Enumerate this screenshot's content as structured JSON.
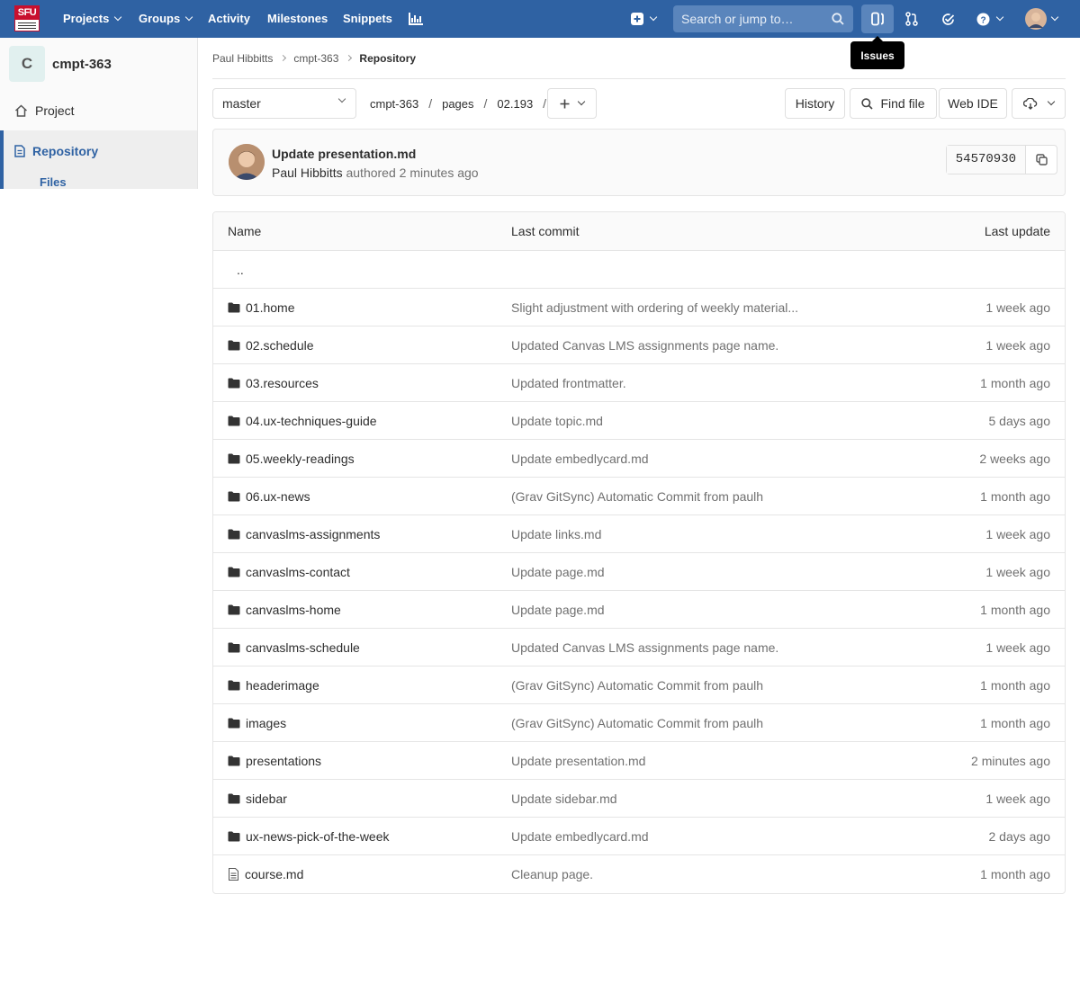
{
  "navbar": {
    "logo_text": "SFU",
    "links": [
      "Projects",
      "Groups",
      "Activity",
      "Milestones",
      "Snippets"
    ],
    "search_placeholder": "Search or jump to…",
    "tooltip": "Issues"
  },
  "sidebar": {
    "project_initial": "C",
    "project_name": "cmpt-363",
    "items": [
      "Project",
      "Repository"
    ],
    "sub_item": "Files"
  },
  "breadcrumb": [
    "Paul Hibbitts",
    "cmpt-363",
    "Repository"
  ],
  "toolbar": {
    "branch": "master",
    "path": [
      "cmpt-363",
      "pages",
      "02.193"
    ],
    "history": "History",
    "find_file": "Find file",
    "web_ide": "Web IDE"
  },
  "commit": {
    "title": "Update presentation.md",
    "author": "Paul Hibbitts",
    "meta": "authored 2 minutes ago",
    "sha": "54570930"
  },
  "table": {
    "headers": [
      "Name",
      "Last commit",
      "Last update"
    ],
    "parent": "..",
    "rows": [
      {
        "name": "01.home",
        "type": "folder",
        "commit": "Slight adjustment with ordering of weekly material...",
        "update": "1 week ago"
      },
      {
        "name": "02.schedule",
        "type": "folder",
        "commit": "Updated Canvas LMS assignments page name.",
        "update": "1 week ago"
      },
      {
        "name": "03.resources",
        "type": "folder",
        "commit": "Updated frontmatter.",
        "update": "1 month ago"
      },
      {
        "name": "04.ux-techniques-guide",
        "type": "folder",
        "commit": "Update topic.md",
        "update": "5 days ago"
      },
      {
        "name": "05.weekly-readings",
        "type": "folder",
        "commit": "Update embedlycard.md",
        "update": "2 weeks ago"
      },
      {
        "name": "06.ux-news",
        "type": "folder",
        "commit": "(Grav GitSync) Automatic Commit from paulh",
        "update": "1 month ago"
      },
      {
        "name": "canvaslms-assignments",
        "type": "folder",
        "commit": "Update links.md",
        "update": "1 week ago"
      },
      {
        "name": "canvaslms-contact",
        "type": "folder",
        "commit": "Update page.md",
        "update": "1 week ago"
      },
      {
        "name": "canvaslms-home",
        "type": "folder",
        "commit": "Update page.md",
        "update": "1 month ago"
      },
      {
        "name": "canvaslms-schedule",
        "type": "folder",
        "commit": "Updated Canvas LMS assignments page name.",
        "update": "1 week ago"
      },
      {
        "name": "headerimage",
        "type": "folder",
        "commit": "(Grav GitSync) Automatic Commit from paulh",
        "update": "1 month ago"
      },
      {
        "name": "images",
        "type": "folder",
        "commit": "(Grav GitSync) Automatic Commit from paulh",
        "update": "1 month ago"
      },
      {
        "name": "presentations",
        "type": "folder",
        "commit": "Update presentation.md",
        "update": "2 minutes ago"
      },
      {
        "name": "sidebar",
        "type": "folder",
        "commit": "Update sidebar.md",
        "update": "1 week ago"
      },
      {
        "name": "ux-news-pick-of-the-week",
        "type": "folder",
        "commit": "Update embedlycard.md",
        "update": "2 days ago"
      },
      {
        "name": "course.md",
        "type": "file",
        "commit": "Cleanup page.",
        "update": "1 month ago"
      }
    ]
  },
  "colors": {
    "navbar": "#2f62a3",
    "accent": "#2f62a3",
    "logo_red": "#c8102e"
  }
}
